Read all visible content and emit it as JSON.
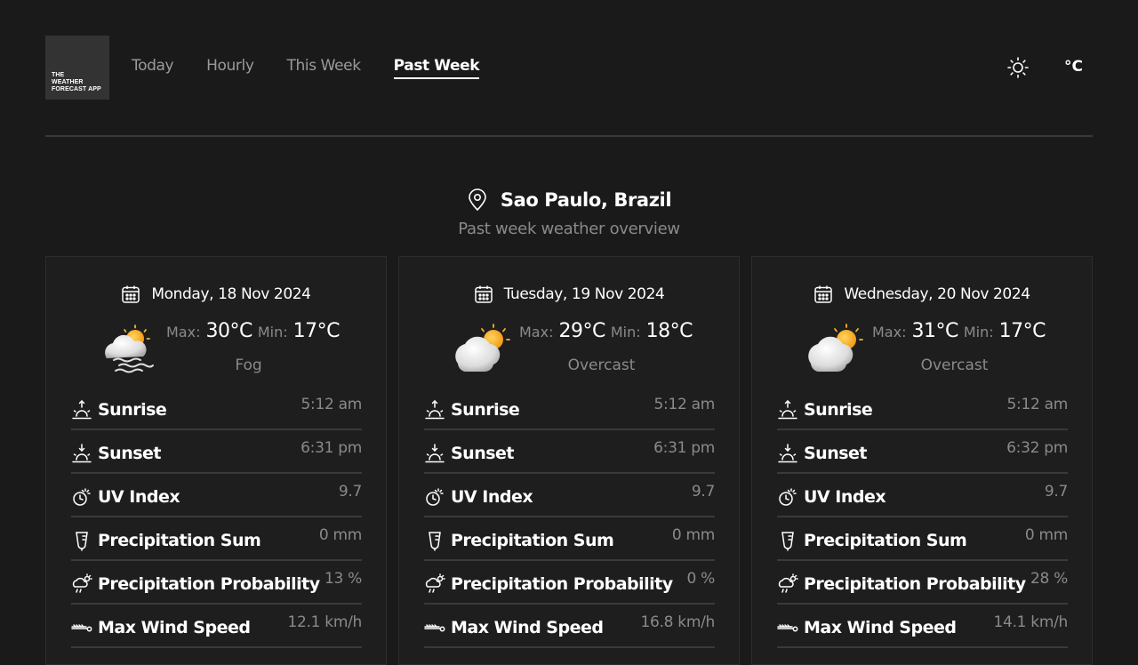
{
  "app": {
    "logo_lines": [
      "THE",
      "WEATHER",
      "FORECAST APP"
    ]
  },
  "nav": {
    "tabs": [
      {
        "label": "Today",
        "active": false
      },
      {
        "label": "Hourly",
        "active": false
      },
      {
        "label": "This Week",
        "active": false
      },
      {
        "label": "Past Week",
        "active": true
      }
    ]
  },
  "header": {
    "theme_icon": "sun-icon",
    "unit_label": "°C"
  },
  "location": {
    "name": "Sao Paulo, Brazil",
    "subtitle": "Past week weather overview",
    "icon": "map-pin-icon"
  },
  "labels": {
    "max": "Max:",
    "min": "Min:"
  },
  "colors": {
    "background": "#1a1a1a",
    "card": "#1e1e1e",
    "muted_text": "#8a8a8a",
    "sun": "#f7b32b"
  },
  "days": [
    {
      "date": "Monday, 18 Nov 2024",
      "max": "30°C",
      "min": "17°C",
      "condition": "Fog",
      "icon": "fog-icon",
      "metrics": [
        {
          "label": "Sunrise",
          "value": "5:12 am",
          "icon": "sunrise-icon"
        },
        {
          "label": "Sunset",
          "value": "6:31 pm",
          "icon": "sunset-icon"
        },
        {
          "label": "UV Index",
          "value": "9.7",
          "icon": "uv-index-icon"
        },
        {
          "label": "Precipitation Sum",
          "value": "0 mm",
          "icon": "rain-gauge-icon"
        },
        {
          "label": "Precipitation Probability",
          "value": "13 %",
          "icon": "cloud-sun-rain-icon"
        },
        {
          "label": "Max Wind Speed",
          "value": "12.1 km/h",
          "icon": "wind-icon"
        }
      ]
    },
    {
      "date": "Tuesday, 19 Nov 2024",
      "max": "29°C",
      "min": "18°C",
      "condition": "Overcast",
      "icon": "overcast-icon",
      "metrics": [
        {
          "label": "Sunrise",
          "value": "5:12 am",
          "icon": "sunrise-icon"
        },
        {
          "label": "Sunset",
          "value": "6:31 pm",
          "icon": "sunset-icon"
        },
        {
          "label": "UV Index",
          "value": "9.7",
          "icon": "uv-index-icon"
        },
        {
          "label": "Precipitation Sum",
          "value": "0 mm",
          "icon": "rain-gauge-icon"
        },
        {
          "label": "Precipitation Probability",
          "value": "0 %",
          "icon": "cloud-sun-rain-icon"
        },
        {
          "label": "Max Wind Speed",
          "value": "16.8 km/h",
          "icon": "wind-icon"
        }
      ]
    },
    {
      "date": "Wednesday, 20 Nov 2024",
      "max": "31°C",
      "min": "17°C",
      "condition": "Overcast",
      "icon": "overcast-icon",
      "metrics": [
        {
          "label": "Sunrise",
          "value": "5:12 am",
          "icon": "sunrise-icon"
        },
        {
          "label": "Sunset",
          "value": "6:32 pm",
          "icon": "sunset-icon"
        },
        {
          "label": "UV Index",
          "value": "9.7",
          "icon": "uv-index-icon"
        },
        {
          "label": "Precipitation Sum",
          "value": "0 mm",
          "icon": "rain-gauge-icon"
        },
        {
          "label": "Precipitation Probability",
          "value": "28 %",
          "icon": "cloud-sun-rain-icon"
        },
        {
          "label": "Max Wind Speed",
          "value": "14.1 km/h",
          "icon": "wind-icon"
        }
      ]
    }
  ]
}
